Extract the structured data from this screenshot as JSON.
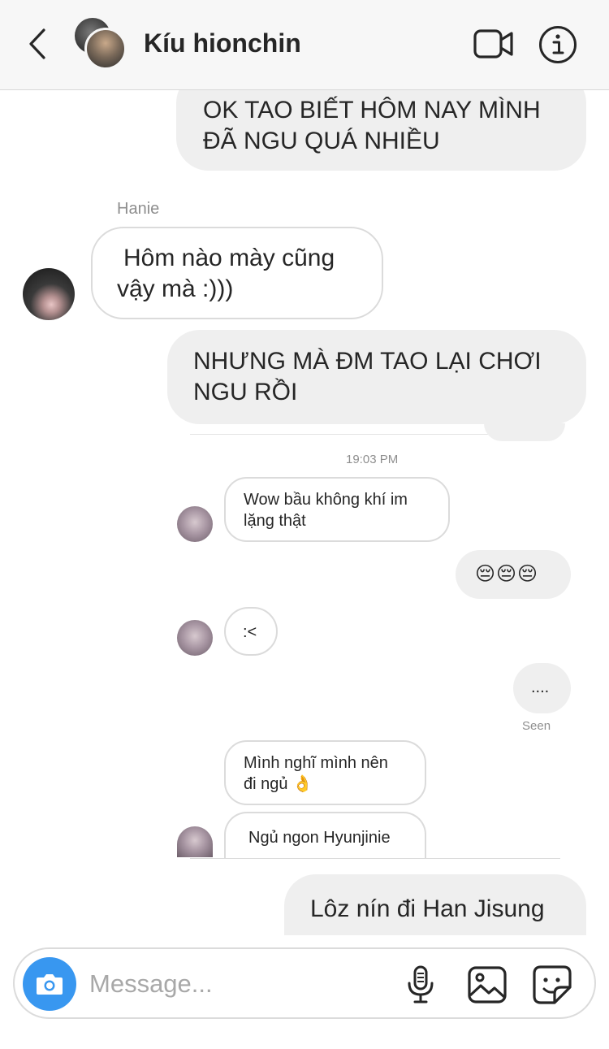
{
  "header": {
    "title": "Kíu hionchin"
  },
  "messages": [
    {
      "id": "m1",
      "side": "out",
      "text_line1": "OK TAO BIẾT HÔM NAY MÌNH",
      "text_line2": "ĐÃ NGU QUÁ NHIỀU"
    },
    {
      "id": "m2",
      "side": "in",
      "sender": "Hanie",
      "text_line1": "Hôm nào mày cũng",
      "text_line2": "vậy mà :)))"
    },
    {
      "id": "m3",
      "side": "out",
      "text_line1": "NHƯNG MÀ ĐM TAO LẠI CHƠI",
      "text_line2": "NGU RỒI"
    },
    {
      "id": "m4",
      "side": "in",
      "text_line1": "Wow bầu không khí im",
      "text_line2": "lặng thật"
    },
    {
      "id": "m5",
      "side": "out",
      "text": "😔😔😔"
    },
    {
      "id": "m6",
      "side": "in",
      "text": ":<"
    },
    {
      "id": "m7",
      "side": "out",
      "text": "...."
    },
    {
      "id": "m8",
      "side": "in",
      "text_line1": "Mình nghĩ mình nên",
      "text_line2": "đi ngủ 👌"
    },
    {
      "id": "m9",
      "side": "in",
      "text": "Ngủ ngon Hyunjinie"
    },
    {
      "id": "m10",
      "side": "out",
      "text": "Lôz nín đi Han Jisung"
    }
  ],
  "timestamp": "19:03 PM",
  "seen_label": "Seen",
  "composer": {
    "placeholder": "Message..."
  },
  "icons": {
    "back": "chevron-left-icon",
    "video": "video-camera-icon",
    "info": "info-icon",
    "camera": "camera-icon",
    "mic": "microphone-icon",
    "gallery": "image-icon",
    "sticker": "sticker-icon"
  },
  "colors": {
    "outgoing_bubble": "#efefef",
    "incoming_border": "#dbdbdb",
    "camera_button": "#3897f0",
    "secondary_text": "#8e8e8e"
  }
}
